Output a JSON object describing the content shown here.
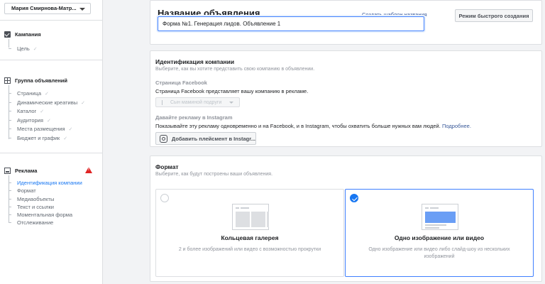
{
  "sidebar": {
    "account": "Мария Смирнова-Матр...",
    "campaign": {
      "label": "Кампания",
      "items": [
        "Цель"
      ]
    },
    "adset": {
      "label": "Группа объявлений",
      "items": [
        "Страница",
        "Динамические креативы",
        "Каталог",
        "Аудитория",
        "Места размещения",
        "Бюджет и график"
      ]
    },
    "ad": {
      "label": "Реклама",
      "warning": "!",
      "items": [
        "Идентификация компании",
        "Формат",
        "Медиаобъекты",
        "Текст и ссылки",
        "Моментальная форма",
        "Отслеживание"
      ]
    }
  },
  "ad_name": {
    "title": "Название объявления",
    "template_link": "Создать шаблон названия",
    "quick_create": "Режим быстрого создания",
    "value": "Форма №1. Генерация лидов. Объявление 1"
  },
  "identity": {
    "title": "Идентификация компании",
    "subtitle": "Выберите, как вы хотите представить свою компанию в объявлении.",
    "fb_label": "Страница Facebook",
    "fb_desc": "Страница Facebook представляет вашу компанию в рекламе.",
    "fb_select": "Сын маминой подруги",
    "ig_label": "Давайте рекламу в Instagram",
    "ig_desc": "Показывайте эту рекламу одновременно и на Facebook, и в Instagram, чтобы охватить больше нужных вам людей.",
    "ig_more": "Подробнее.",
    "ig_button": "Добавить плейсмент в Instagr..."
  },
  "format": {
    "title": "Формат",
    "subtitle": "Выберите, как будут построены ваши объявления.",
    "options": [
      {
        "title": "Кольцевая галерея",
        "desc": "2 и более изображений или видео с возможностью прокрутки",
        "selected": false
      },
      {
        "title": "Одно изображение или видео",
        "desc": "Одно изображение или видео либо слайд-шоу из нескольких изображений",
        "selected": true
      }
    ]
  },
  "colors": {
    "accent": "#1877f2",
    "warning": "#e02424",
    "link": "#385898"
  }
}
